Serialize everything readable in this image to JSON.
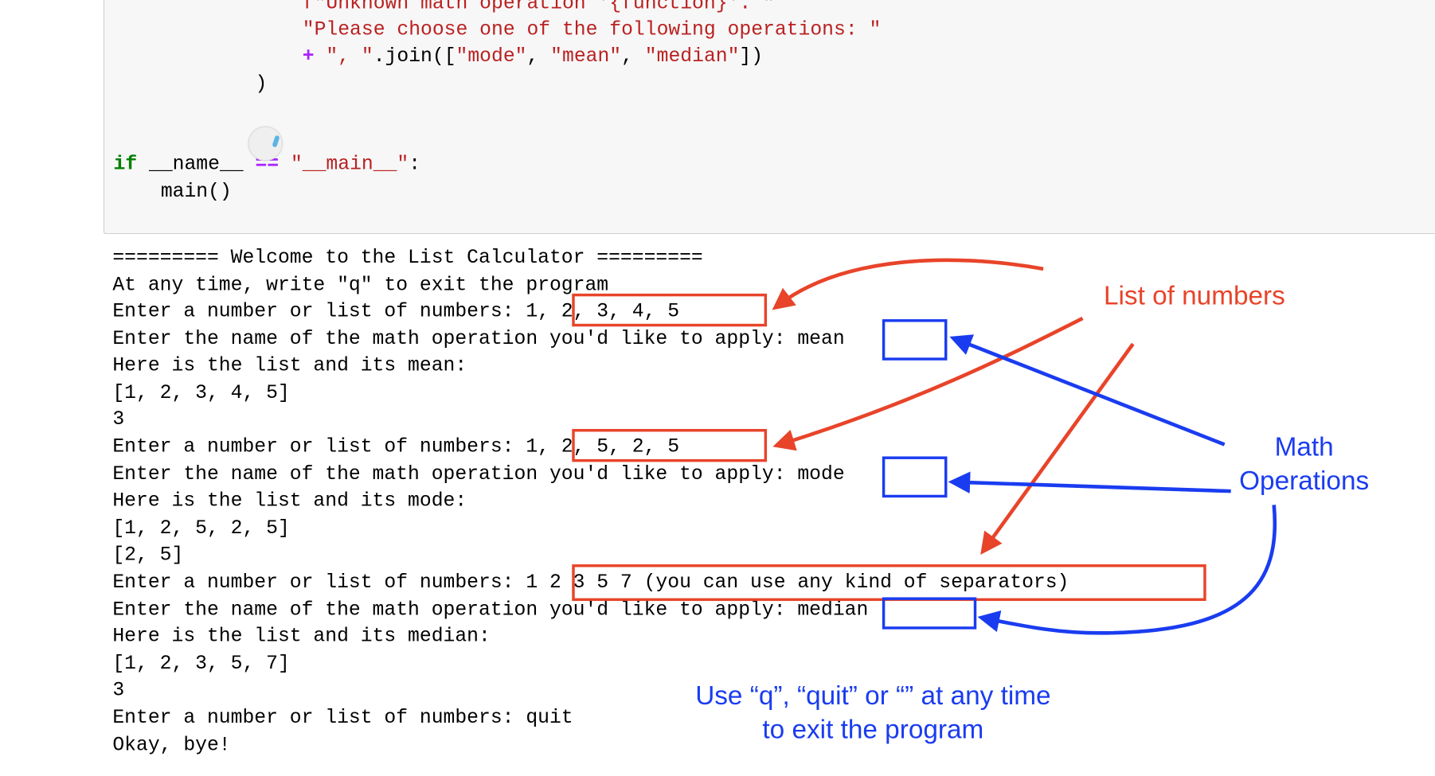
{
  "code_cell": {
    "lines": [
      {
        "indent": "                ",
        "text": "f\"Unknown math operation '{function}'. \""
      },
      {
        "indent": "                ",
        "text": "\"Please choose one of the following operations: \""
      },
      {
        "indent": "                ",
        "plus": "+",
        "sep": "\", \"",
        "join": ".join([",
        "opt1": "\"mode\"",
        "c1": ", ",
        "opt2": "\"mean\"",
        "c2": ", ",
        "opt3": "\"median\"",
        "end": "])"
      },
      {
        "indent": "            ",
        "text": ")"
      }
    ],
    "main_guard": {
      "keyword": "if",
      "name": " __name__ ",
      "op": "==",
      "value": "\"__main__\"",
      "colon": ":",
      "call": "    main()"
    },
    "spinner_icon": "loading-spinner-icon"
  },
  "output": {
    "lines": [
      "========= Welcome to the List Calculator =========",
      "At any time, write \"q\" to exit the program",
      "Enter a number or list of numbers: 1, 2, 3, 4, 5",
      "Enter the name of the math operation you'd like to apply: mean",
      "Here is the list and its mean:",
      "[1, 2, 3, 4, 5]",
      "3",
      "Enter a number or list of numbers: 1, 2, 5, 2, 5",
      "Enter the name of the math operation you'd like to apply: mode",
      "Here is the list and its mode:",
      "[1, 2, 5, 2, 5]",
      "[2, 5]",
      "Enter a number or list of numbers: 1 2 3 5 7 (you can use any kind of separators)",
      "Enter the name of the math operation you'd like to apply: median",
      "Here is the list and its median:",
      "[1, 2, 3, 5, 7]",
      "3",
      "Enter a number or list of numbers: quit",
      "Okay, bye!"
    ]
  },
  "annotations": {
    "list_of_numbers": "List of numbers",
    "math_operations_line1": "Math",
    "math_operations_line2": "Operations",
    "exit_hint_line1": "Use “q”, “quit” or “” at any time",
    "exit_hint_line2": "to exit the program",
    "colors": {
      "numbers_highlight": "#e8442a",
      "operations_highlight": "#1a3cf0"
    }
  }
}
